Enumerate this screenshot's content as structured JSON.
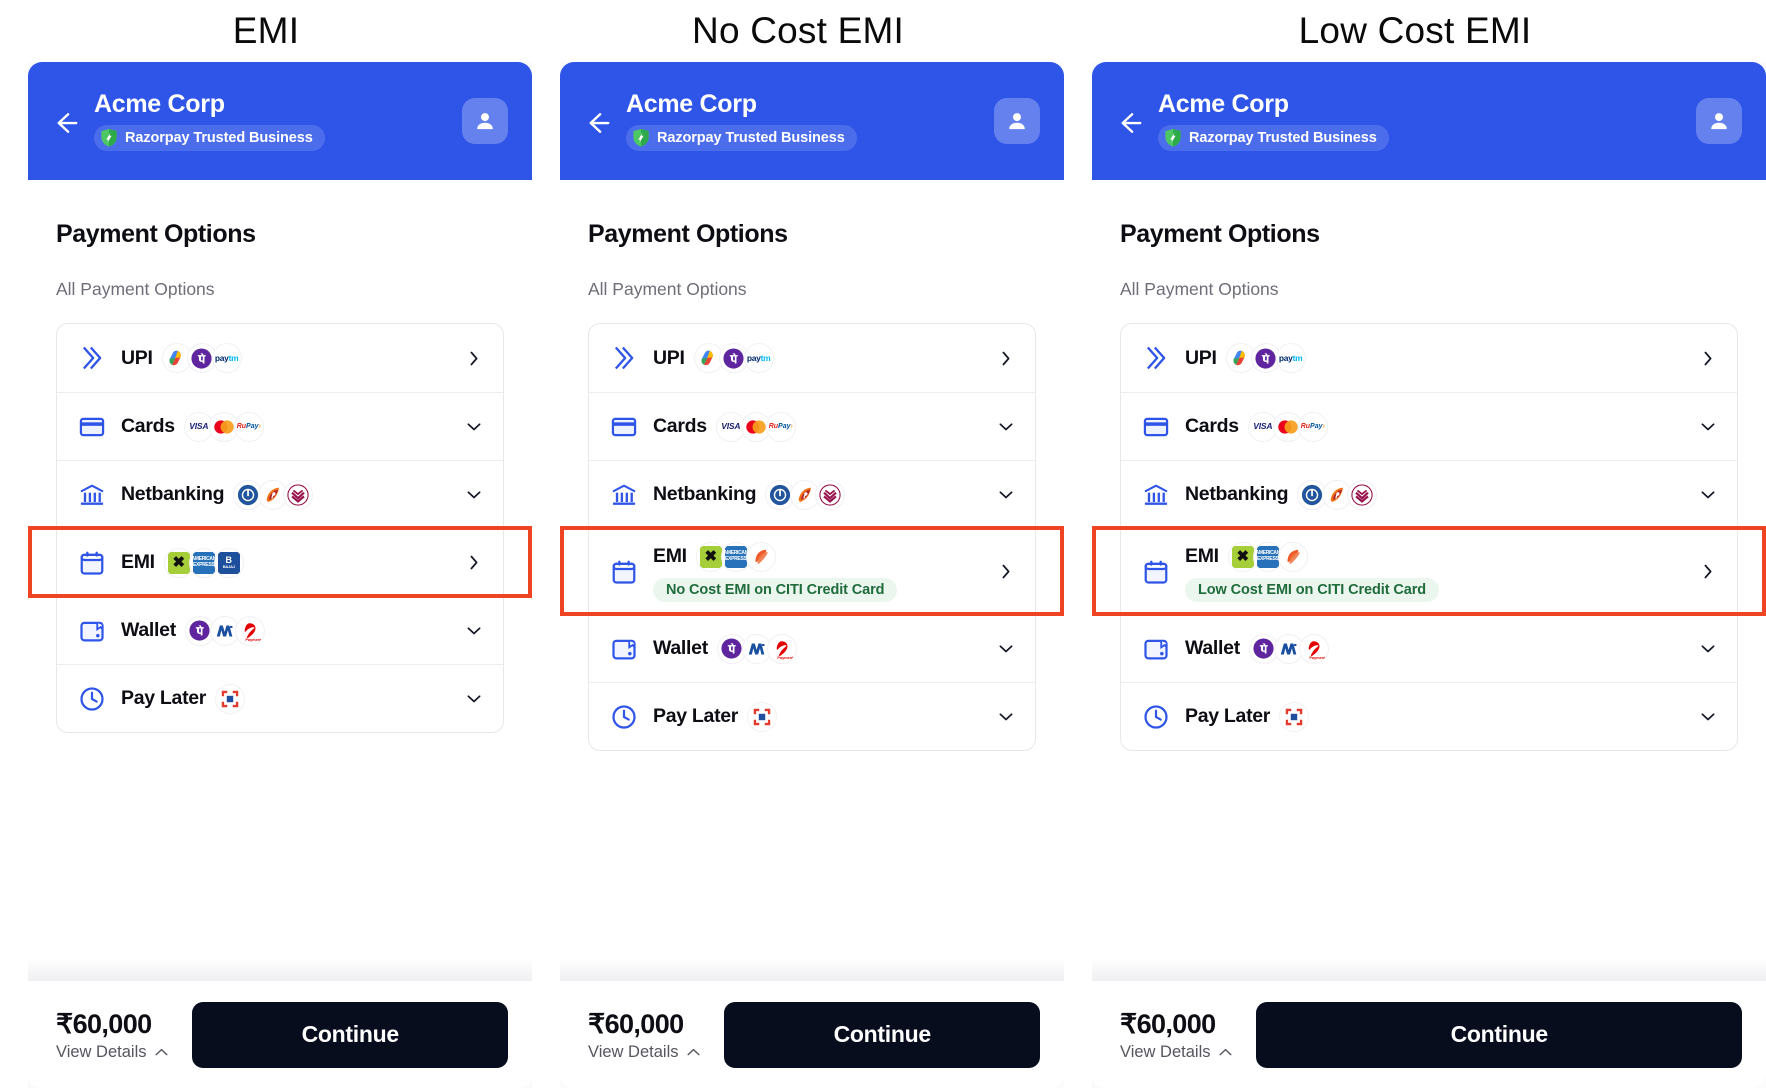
{
  "panels": [
    {
      "caption": "EMI",
      "header": {
        "merchant": "Acme Corp",
        "trust_label": "Razorpay Trusted Business",
        "back_icon": "back-arrow-icon",
        "avatar_icon": "user-avatar-icon",
        "bg_color": "#2f55e8"
      },
      "section_title": "Payment Options",
      "sub_title": "All Payment Options",
      "options": [
        {
          "label": "UPI",
          "icon": "upi-chevrons-icon",
          "chevron": "chevron-right",
          "logos": [
            "gpay",
            "phonepe",
            "paytm"
          ],
          "offer": null,
          "highlight": false
        },
        {
          "label": "Cards",
          "icon": "card-icon",
          "chevron": "chevron-down",
          "logos": [
            "visa",
            "mastercard",
            "rupay"
          ],
          "offer": null,
          "highlight": false
        },
        {
          "label": "Netbanking",
          "icon": "bank-icon",
          "chevron": "chevron-down",
          "logos": [
            "sbi",
            "icici",
            "axis"
          ],
          "offer": null,
          "highlight": false
        },
        {
          "label": "EMI",
          "icon": "calendar-icon",
          "chevron": "chevron-right",
          "logos": [
            "hdfc",
            "amex",
            "bajaj"
          ],
          "offer": null,
          "highlight": true
        },
        {
          "label": "Wallet",
          "icon": "wallet-icon",
          "chevron": "chevron-down",
          "logos": [
            "phonepe",
            "mobikwik",
            "airtel"
          ],
          "offer": null,
          "highlight": false
        },
        {
          "label": "Pay Later",
          "icon": "clock-icon",
          "chevron": "chevron-down",
          "logos": [
            "lazypay"
          ],
          "offer": null,
          "highlight": false
        }
      ],
      "footer": {
        "amount": "₹60,000",
        "view_details": "View Details",
        "chevron": "chevron-up",
        "continue_label": "Continue"
      }
    },
    {
      "caption": "No Cost EMI",
      "header": {
        "merchant": "Acme Corp",
        "trust_label": "Razorpay Trusted Business",
        "back_icon": "back-arrow-icon",
        "avatar_icon": "user-avatar-icon",
        "bg_color": "#2f55e8"
      },
      "section_title": "Payment Options",
      "sub_title": "All Payment Options",
      "options": [
        {
          "label": "UPI",
          "icon": "upi-chevrons-icon",
          "chevron": "chevron-right",
          "logos": [
            "gpay",
            "phonepe",
            "paytm"
          ],
          "offer": null,
          "highlight": false
        },
        {
          "label": "Cards",
          "icon": "card-icon",
          "chevron": "chevron-down",
          "logos": [
            "visa",
            "mastercard",
            "rupay"
          ],
          "offer": null,
          "highlight": false
        },
        {
          "label": "Netbanking",
          "icon": "bank-icon",
          "chevron": "chevron-down",
          "logos": [
            "sbi",
            "icici",
            "axis"
          ],
          "offer": null,
          "highlight": false
        },
        {
          "label": "EMI",
          "icon": "calendar-icon",
          "chevron": "chevron-right",
          "logos": [
            "hdfc",
            "amex",
            "bob"
          ],
          "offer": "No Cost EMI on CITI Credit Card",
          "highlight": true
        },
        {
          "label": "Wallet",
          "icon": "wallet-icon",
          "chevron": "chevron-down",
          "logos": [
            "phonepe",
            "mobikwik",
            "airtel"
          ],
          "offer": null,
          "highlight": false
        },
        {
          "label": "Pay Later",
          "icon": "clock-icon",
          "chevron": "chevron-down",
          "logos": [
            "lazypay"
          ],
          "offer": null,
          "highlight": false
        }
      ],
      "footer": {
        "amount": "₹60,000",
        "view_details": "View Details",
        "chevron": "chevron-up",
        "continue_label": "Continue"
      }
    },
    {
      "caption": "Low Cost EMI",
      "header": {
        "merchant": "Acme Corp",
        "trust_label": "Razorpay Trusted Business",
        "back_icon": "back-arrow-icon",
        "avatar_icon": "user-avatar-icon",
        "bg_color": "#2f55e8"
      },
      "section_title": "Payment Options",
      "sub_title": "All Payment Options",
      "options": [
        {
          "label": "UPI",
          "icon": "upi-chevrons-icon",
          "chevron": "chevron-right",
          "logos": [
            "gpay",
            "phonepe",
            "paytm"
          ],
          "offer": null,
          "highlight": false
        },
        {
          "label": "Cards",
          "icon": "card-icon",
          "chevron": "chevron-down",
          "logos": [
            "visa",
            "mastercard",
            "rupay"
          ],
          "offer": null,
          "highlight": false
        },
        {
          "label": "Netbanking",
          "icon": "bank-icon",
          "chevron": "chevron-down",
          "logos": [
            "sbi",
            "icici",
            "axis"
          ],
          "offer": null,
          "highlight": false
        },
        {
          "label": "EMI",
          "icon": "calendar-icon",
          "chevron": "chevron-right",
          "logos": [
            "hdfc",
            "amex",
            "bob"
          ],
          "offer": "Low Cost EMI on CITI Credit Card",
          "highlight": true
        },
        {
          "label": "Wallet",
          "icon": "wallet-icon",
          "chevron": "chevron-down",
          "logos": [
            "phonepe",
            "mobikwik",
            "airtel"
          ],
          "offer": null,
          "highlight": false
        },
        {
          "label": "Pay Later",
          "icon": "clock-icon",
          "chevron": "chevron-down",
          "logos": [
            "lazypay"
          ],
          "offer": null,
          "highlight": false
        }
      ],
      "footer": {
        "amount": "₹60,000",
        "view_details": "View Details",
        "chevron": "chevron-up",
        "continue_label": "Continue"
      }
    }
  ],
  "colors": {
    "header_blue": "#2f55e8",
    "highlight_red": "#ef4423",
    "offer_green_text": "#1f6b3b",
    "offer_green_bg": "#eaf6ee",
    "cta_dark": "#080d1e",
    "icon_blue": "#2f55e8"
  }
}
